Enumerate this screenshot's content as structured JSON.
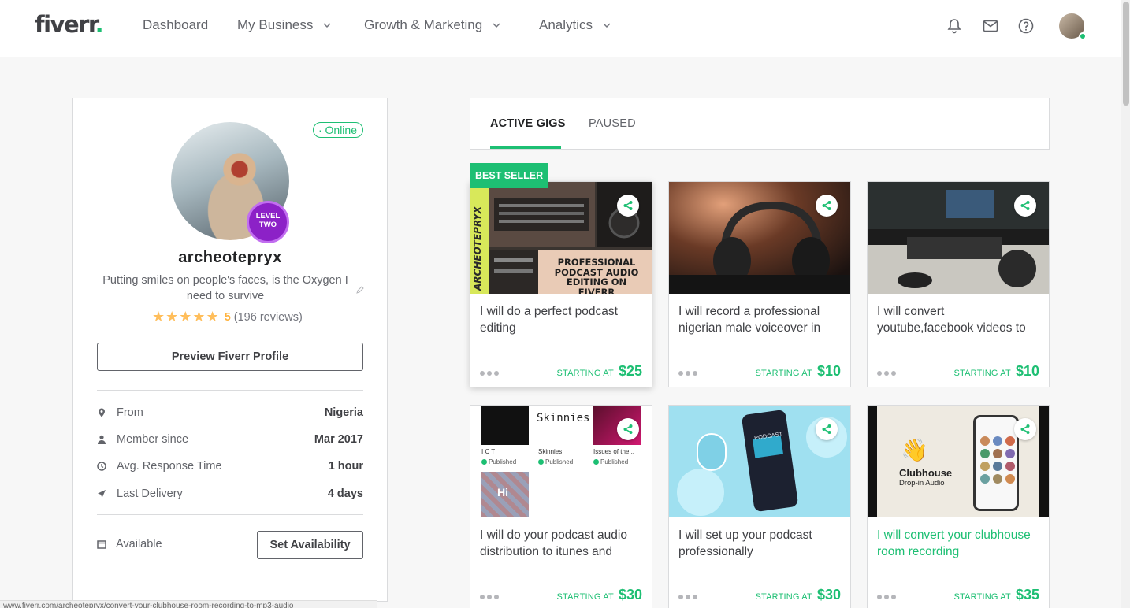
{
  "header": {
    "logo": "fiverr",
    "logo_dot": ".",
    "nav": [
      {
        "label": "Dashboard"
      },
      {
        "label": "My Business"
      },
      {
        "label": "Growth & Marketing"
      },
      {
        "label": "Analytics"
      }
    ]
  },
  "profile": {
    "status": "· Online",
    "level_line1": "LEVEL",
    "level_line2": "TWO",
    "username": "archeotepryx",
    "tagline": "Putting smiles on people's faces, is the Oxygen I need to survive",
    "stars": "★★★★★",
    "rating": "5",
    "reviews": "(196 reviews)",
    "preview_button": "Preview Fiverr Profile",
    "stats": [
      {
        "label": "From",
        "value": "Nigeria",
        "icon": "location-pin-icon"
      },
      {
        "label": "Member since",
        "value": "Mar 2017",
        "icon": "user-icon"
      },
      {
        "label": "Avg. Response Time",
        "value": "1 hour",
        "icon": "clock-icon"
      },
      {
        "label": "Last Delivery",
        "value": "4 days",
        "icon": "send-icon"
      }
    ],
    "availability_label": "Available",
    "set_availability_button": "Set Availability"
  },
  "tabs": {
    "active": "ACTIVE GIGS",
    "paused": "PAUSED"
  },
  "badge": "BEST SELLER",
  "gigs": [
    {
      "title": "I will do a perfect podcast editing",
      "price_label": "STARTING AT",
      "price": "$25",
      "thumb_text": "PROFESSIONAL PODCAST AUDIO EDITING ON FIVERR",
      "thumb_side": "ARCHEOTEPRYX"
    },
    {
      "title": "I will record a professional nigerian male voiceover in",
      "price_label": "STARTING AT",
      "price": "$10"
    },
    {
      "title": "I will convert youtube,facebook videos to",
      "price_label": "STARTING AT",
      "price": "$10"
    },
    {
      "title": "I will do your podcast audio distribution to itunes and",
      "price_label": "STARTING AT",
      "price": "$30",
      "thumb_items": [
        {
          "name": "I C T",
          "status": "Published"
        },
        {
          "name": "Skinnies",
          "status": "Published"
        },
        {
          "name": "Issues of the...",
          "status": "Published"
        }
      ],
      "thumb_logo": "Skinnies",
      "thumb_hi": "Hi"
    },
    {
      "title": "I will set up your podcast professionally",
      "price_label": "STARTING AT",
      "price": "$30",
      "thumb_phone": "PODCAST"
    },
    {
      "title": "I will convert your clubhouse room recording",
      "price_label": "STARTING AT",
      "price": "$35",
      "thumb_brand": "Clubhouse",
      "thumb_sub": "Drop-in Audio"
    }
  ],
  "status_url": "www.fiverr.com/archeotepryx/convert-your-clubhouse-room-recording-to-mp3-audio",
  "colors": {
    "brand": "#1dbf73",
    "level": "#8c21c7",
    "star": "#ffbe5b"
  }
}
